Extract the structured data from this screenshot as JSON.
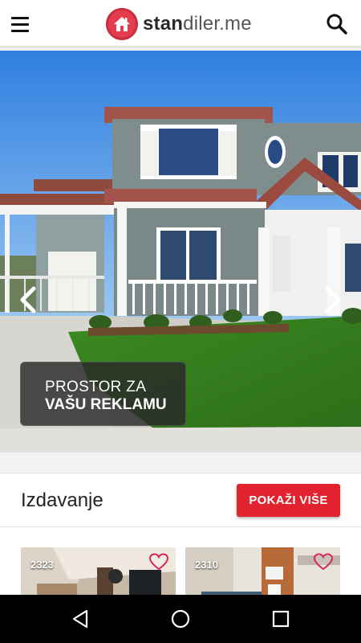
{
  "header": {
    "logo_bold": "stan",
    "logo_rest": "diler.me",
    "menu_icon": "hamburger-menu-icon",
    "search_icon": "search-icon"
  },
  "hero": {
    "ad_line1": "PROSTOR ZA",
    "ad_line2": "VAŠU REKLAMU"
  },
  "listing": {
    "title": "Izdavanje",
    "show_more_label": "POKAŽI VIŠE",
    "cards": [
      {
        "id": "2323"
      },
      {
        "id": "2310"
      }
    ]
  },
  "colors": {
    "brand_red": "#e43d4d",
    "button_red": "#e2222e"
  }
}
